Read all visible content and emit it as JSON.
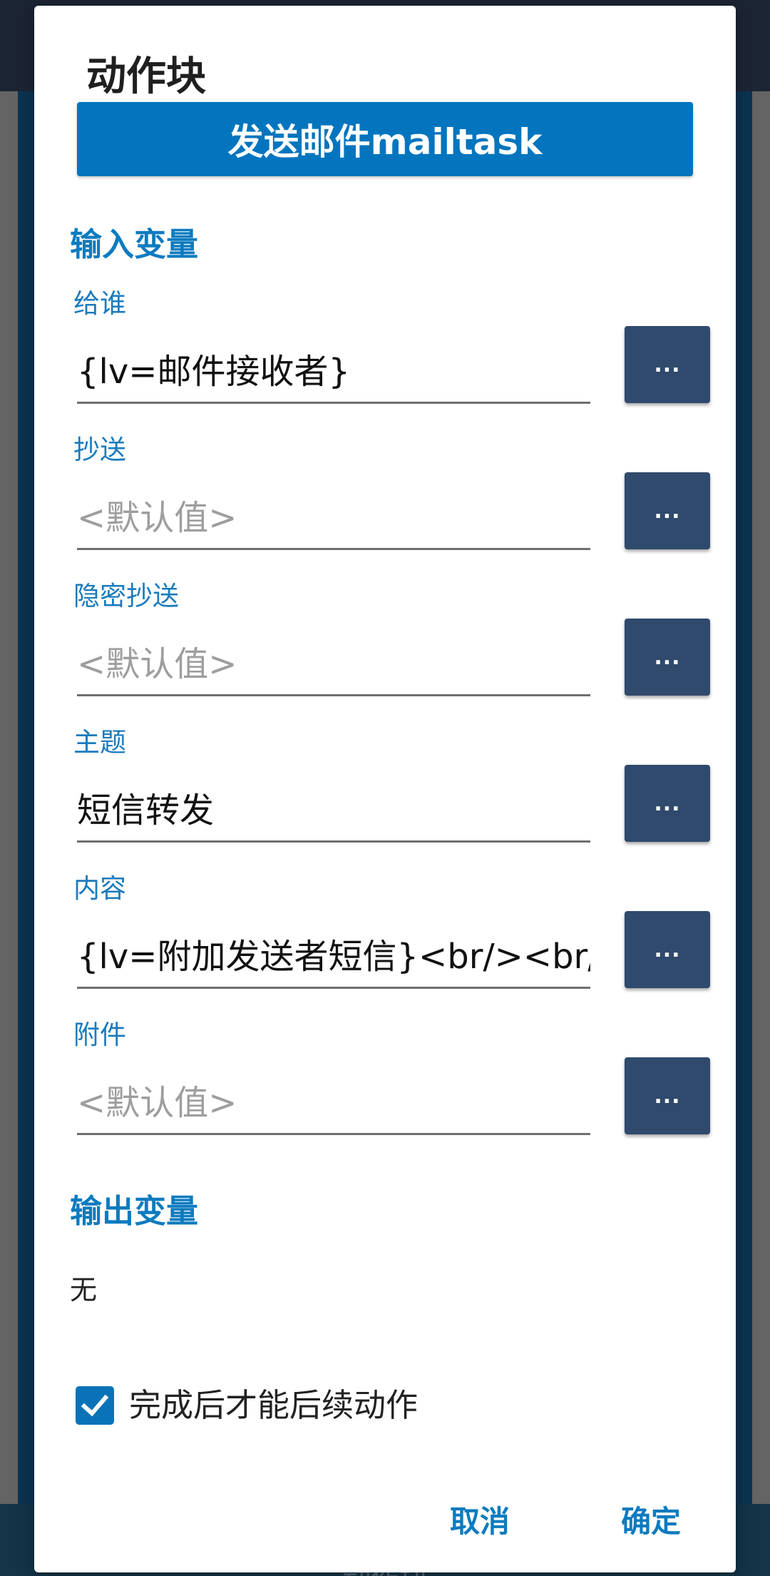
{
  "background": {
    "bottom_text": "动作块"
  },
  "dialog": {
    "title": "动作块",
    "action_button_label": "发送邮件mailtask",
    "input_section_title": "输入变量",
    "output_section_title": "输出变量",
    "output_none": "无",
    "more_button_label": "...",
    "fields": [
      {
        "label": "给谁",
        "value": "{lv=邮件接收者}",
        "is_placeholder": false
      },
      {
        "label": "抄送",
        "value": "<默认值>",
        "is_placeholder": true
      },
      {
        "label": "隐密抄送",
        "value": "<默认值>",
        "is_placeholder": true
      },
      {
        "label": "主题",
        "value": "短信转发",
        "is_placeholder": false
      },
      {
        "label": "内容",
        "value": "{lv=附加发送者短信}<br/><br/>",
        "is_placeholder": false
      },
      {
        "label": "附件",
        "value": "<默认值>",
        "is_placeholder": true
      }
    ],
    "checkbox": {
      "label": "完成后才能后续动作",
      "checked": true
    },
    "cancel_label": "取消",
    "confirm_label": "确定"
  },
  "colors": {
    "accent": "#0d7bbf",
    "action_button": "#0275be",
    "more_button": "#2f4a6c",
    "checkbox": "#0a73b8"
  }
}
